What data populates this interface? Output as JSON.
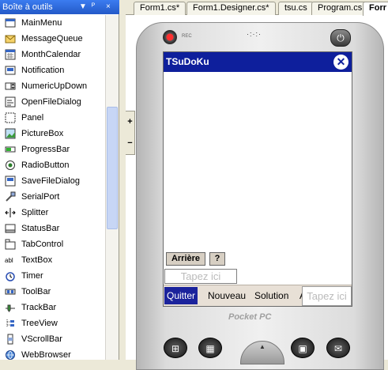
{
  "toolbox": {
    "title": "Boîte à outils",
    "controls": [
      "▼",
      "ᴾ",
      "×"
    ],
    "items": [
      {
        "label": "MainMenu",
        "icon": "main-menu-icon"
      },
      {
        "label": "MessageQueue",
        "icon": "message-queue-icon"
      },
      {
        "label": "MonthCalendar",
        "icon": "month-calendar-icon"
      },
      {
        "label": "Notification",
        "icon": "notification-icon"
      },
      {
        "label": "NumericUpDown",
        "icon": "numeric-updown-icon"
      },
      {
        "label": "OpenFileDialog",
        "icon": "open-file-dialog-icon"
      },
      {
        "label": "Panel",
        "icon": "panel-icon"
      },
      {
        "label": "PictureBox",
        "icon": "picture-box-icon"
      },
      {
        "label": "ProgressBar",
        "icon": "progress-bar-icon"
      },
      {
        "label": "RadioButton",
        "icon": "radio-button-icon"
      },
      {
        "label": "SaveFileDialog",
        "icon": "save-file-dialog-icon"
      },
      {
        "label": "SerialPort",
        "icon": "serial-port-icon"
      },
      {
        "label": "Splitter",
        "icon": "splitter-icon"
      },
      {
        "label": "StatusBar",
        "icon": "status-bar-icon"
      },
      {
        "label": "TabControl",
        "icon": "tab-control-icon"
      },
      {
        "label": "TextBox",
        "icon": "text-box-icon"
      },
      {
        "label": "Timer",
        "icon": "timer-icon"
      },
      {
        "label": "ToolBar",
        "icon": "toolbar-icon"
      },
      {
        "label": "TrackBar",
        "icon": "track-bar-icon"
      },
      {
        "label": "TreeView",
        "icon": "tree-view-icon"
      },
      {
        "label": "VScrollBar",
        "icon": "vscrollbar-icon"
      },
      {
        "label": "WebBrowser",
        "icon": "web-browser-icon"
      }
    ]
  },
  "tabs": [
    "Form1.cs*",
    "Form1.Designer.cs*",
    "tsu.cs",
    "Program.cs",
    "Forr"
  ],
  "expand": {
    "plus": "+",
    "minus": "−"
  },
  "device": {
    "rec_label": "REC",
    "speaker": "·:·:·",
    "power_icon": "⏻",
    "brand": "Pocket PC",
    "nav_icons": [
      "⊞",
      "▦",
      "▣",
      "✉"
    ],
    "dpad_arrow": "▲"
  },
  "form": {
    "title": "TSuDoKu",
    "close_glyph": "✕",
    "back_button": "Arrière",
    "help_button": "?",
    "input_placeholder": "Tapez ici",
    "menu": [
      "Quitter",
      "Nouveau",
      "Solution",
      "Aide"
    ],
    "menu_input_placeholder": "Tapez ici"
  },
  "colors": {
    "titlebar": "#0e1f9c",
    "menu_selected": "#1b239c",
    "toolbox_title": "#2359c8"
  }
}
